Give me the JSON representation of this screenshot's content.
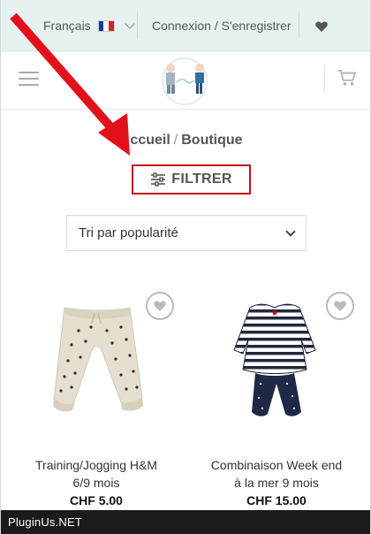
{
  "topbar": {
    "language": "Français",
    "login": "Connexion / S'enregistrer"
  },
  "breadcrumb": {
    "home": "ccueil",
    "separator": "/",
    "current": "Boutique"
  },
  "filter": {
    "label": "FILTRER"
  },
  "sort": {
    "selected": "Tri par popularité"
  },
  "products": [
    {
      "name_line1": "Training/Jogging H&M",
      "name_line2": "6/9 mois",
      "price": "CHF 5.00"
    },
    {
      "name_line1": "Combinaison Week end",
      "name_line2": "à la mer 9 mois",
      "price": "CHF 15.00"
    }
  ],
  "watermark": "PluginUs.NET",
  "colors": {
    "annotation_red": "#e3101b",
    "topbar_bg": "#e6f2f2"
  }
}
